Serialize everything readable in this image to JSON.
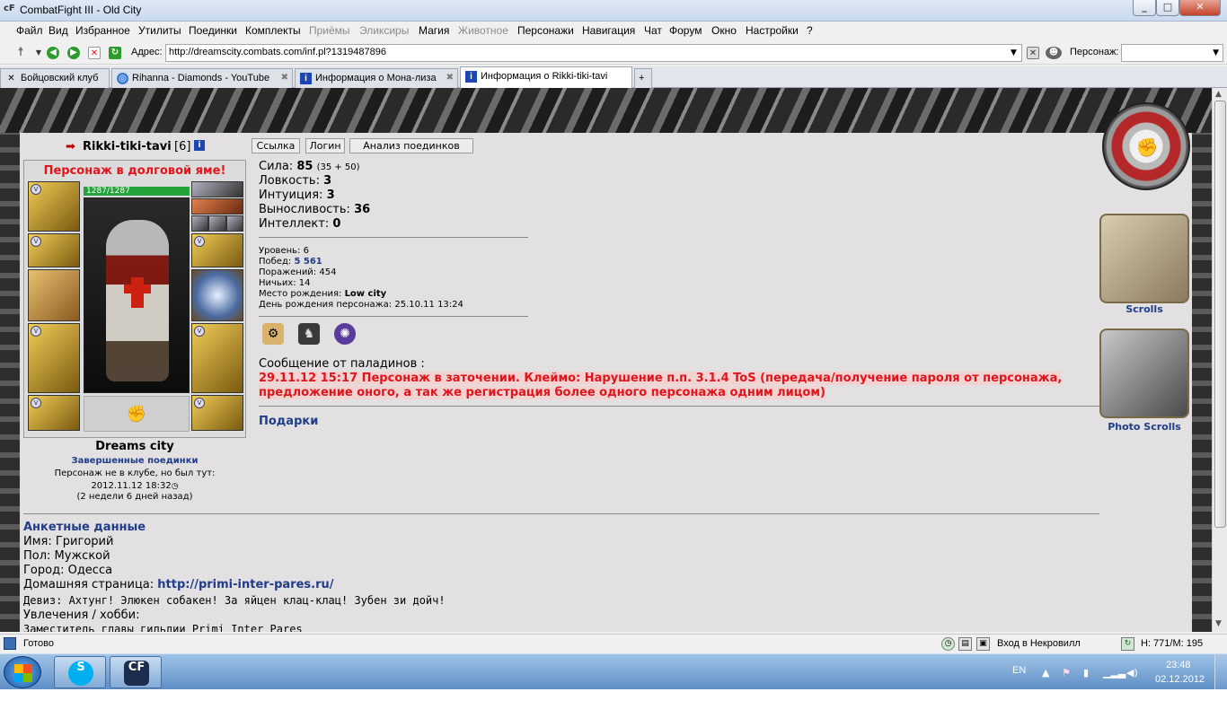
{
  "window": {
    "title": "CombatFight III - Old City",
    "app_icon": "cF",
    "min": "_",
    "max": "□",
    "close": "✕"
  },
  "menu": [
    "Файл",
    "Вид",
    "Избранное",
    "Утилиты",
    "Поединки",
    "Комплекты",
    "Приёмы",
    "Эликсиры",
    "Магия",
    "Животное",
    "Персонажи",
    "Навигация",
    "Чат",
    "Форум",
    "Окно",
    "Настройки",
    "?"
  ],
  "menu_disabled": [
    "Приёмы",
    "Эликсиры",
    "Животное"
  ],
  "address": {
    "label": "Адрес:",
    "url": "http://dreamscity.combats.com/inf.pl?1319487896",
    "persona_label": "Персонаж:",
    "persona_value": ""
  },
  "tabs": [
    {
      "label": "Бойцовский клуб",
      "icon": "crossed-swords-icon"
    },
    {
      "label": "Rihanna - Diamonds - YouTube",
      "icon": "globe-icon"
    },
    {
      "label": "Информация о Мона-лиза",
      "icon": "info-icon"
    },
    {
      "label": "Информация о Rikki-tiki-tavi",
      "icon": "info-icon",
      "active": true
    }
  ],
  "character": {
    "name": "Rikki-tiki-tavi",
    "level_tag": "[6]",
    "debt_warning": "Персонаж в долговой яме!",
    "hp": "1287/1287",
    "hp_fraction": 1.0,
    "city": "Dreams city",
    "fights_link": "Завершенные поединки",
    "not_in_club": "Персонаж не в клубе, но был тут:",
    "last_seen": "2012.11.12 18:32",
    "ago": "(2 недели 6 дней назад)"
  },
  "buttons": {
    "link": "Ссылка",
    "login": "Логин",
    "analysis": "Анализ поединков"
  },
  "stats": {
    "strength_label": "Сила:",
    "strength_value": "85",
    "strength_detail": "(35 + 50)",
    "agility_label": "Ловкость:",
    "agility_value": "3",
    "intuition_label": "Интуиция:",
    "intuition_value": "3",
    "endurance_label": "Выносливость:",
    "endurance_value": "36",
    "intellect_label": "Интеллект:",
    "intellect_value": "0"
  },
  "info": {
    "level": "Уровень: 6",
    "wins_label": "Побед:",
    "wins_value": "5 561",
    "losses": "Поражений: 454",
    "draws": "Ничьих: 14",
    "birthplace_label": "Место рождения:",
    "birthplace_value": "Low city",
    "birthday": "День рождения персонажа: 25.10.11 13:24"
  },
  "paladins": {
    "title": "Сообщение от паладинов :",
    "line1": "29.11.12 15:17 Персонаж в заточении. Клеймо: Нарушение п.п. 3.1.4 ToS (передача/получение пароля от персонажа,",
    "line2": "предложение оного, а так же регистрация более одного персонажа одним лицом)"
  },
  "gifts": "Подарки",
  "sidebar": {
    "scrolls": "Scrolls",
    "photo_scrolls": "Photo Scrolls"
  },
  "profile": {
    "title": "Анкетные данные",
    "name": "Имя: Григорий",
    "gender": "Пол: Мужской",
    "city": "Город: Одесса",
    "homepage_label": "Домашняя страница:",
    "homepage_url": "http://primi-inter-pares.ru/",
    "motto": "Девиз: Ахтунг! Элюкен собакен! За яйцен клац-клац! Зубен зи дойч!",
    "hobbies": "Увлечения / хобби:",
    "hobby_line": "Заместитель главы гильдии Primi Inter Pares"
  },
  "statusbar": {
    "status": "Готово",
    "necro": "Вход в Некровилл",
    "hm": "Н: 771/М: 195"
  },
  "taskbar": {
    "lang": "EN",
    "time": "23:48",
    "date": "02.12.2012",
    "app_cf": "CF"
  },
  "colors": {
    "warning_red": "#e0141a",
    "link_blue": "#1f3d8a",
    "hp_green": "#23a33a"
  }
}
